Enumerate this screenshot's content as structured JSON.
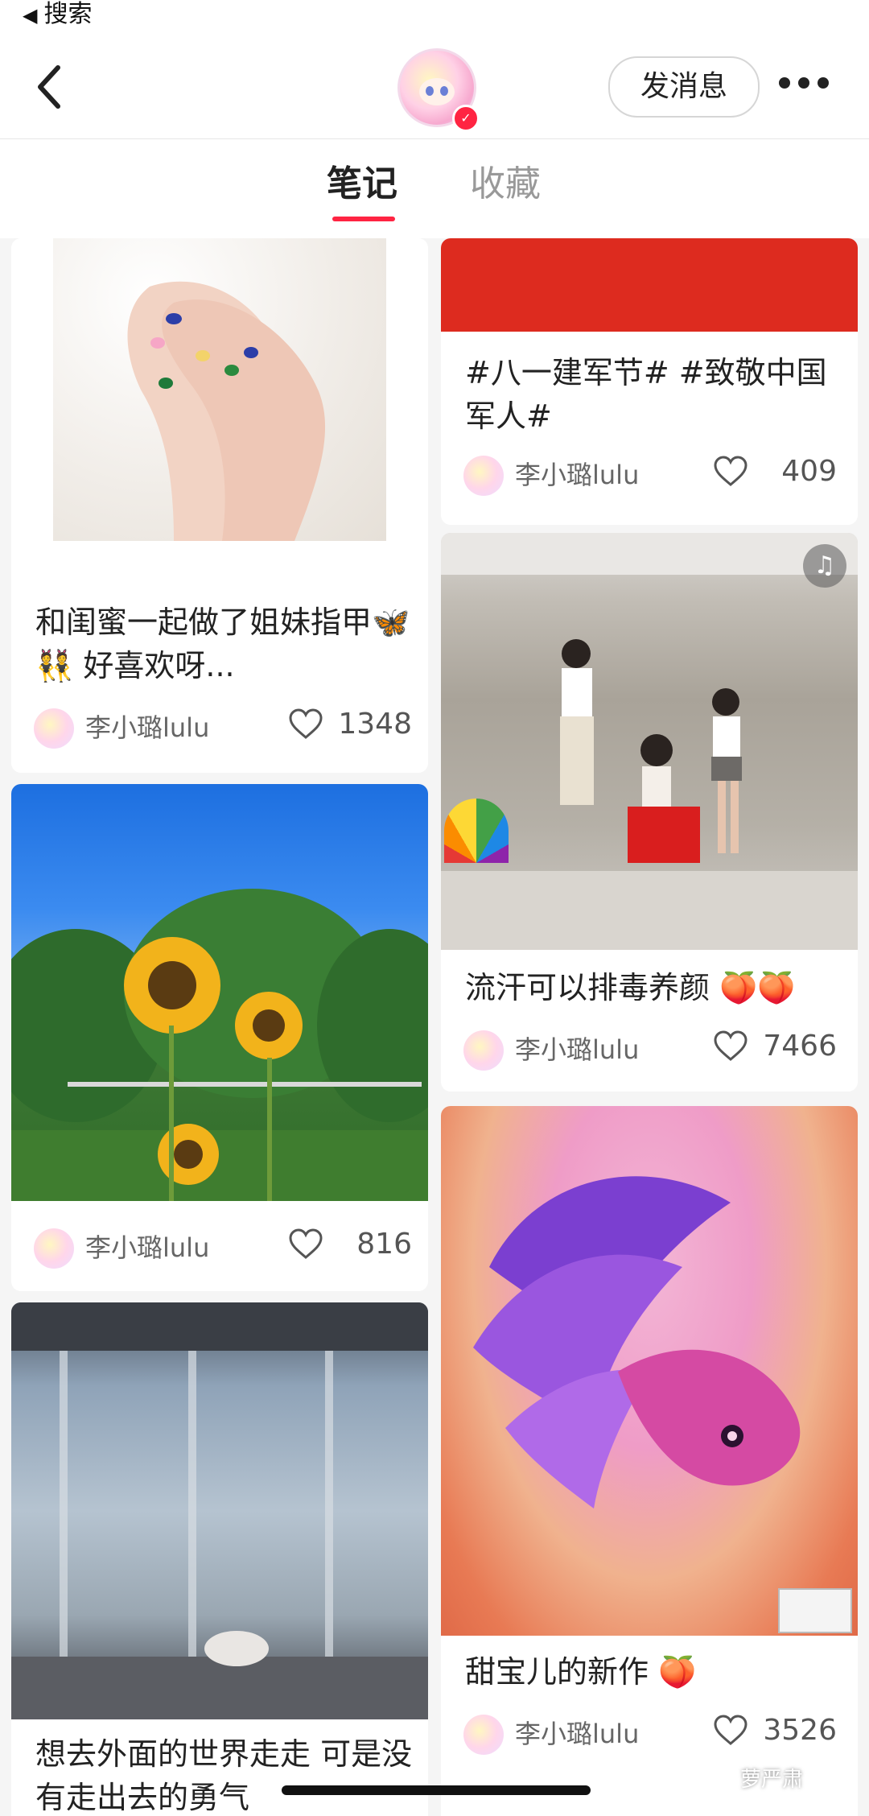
{
  "status_bar": {
    "back_label": "搜索"
  },
  "header": {
    "message_button": "发消息"
  },
  "tabs": [
    {
      "label": "笔记",
      "active": true
    },
    {
      "label": "收藏",
      "active": false
    }
  ],
  "accent_color": "#ff2442",
  "notes": [
    {
      "title": "和闺蜜一起做了姐妹指甲🦋👯 好喜欢呀...",
      "author": "李小璐lulu",
      "likes": "1348",
      "image": "nail-art-hands"
    },
    {
      "title": "#八一建军节# #致敬中国军人#",
      "author": "李小璐lulu",
      "likes": "409",
      "image": "red-banner"
    },
    {
      "title": "流汗可以排毒养颜 🍑🍑",
      "author": "李小璐lulu",
      "likes": "7466",
      "image": "dance-studio-photo",
      "has_music": true
    },
    {
      "title": "",
      "author": "李小璐lulu",
      "likes": "816",
      "image": "sunflowers"
    },
    {
      "title": "甜宝儿的新作 🍑",
      "author": "李小璐lulu",
      "likes": "3526",
      "image": "fish-painting"
    },
    {
      "title": "想去外面的世界走走 可是没有走出去的勇气",
      "author": "",
      "likes": "",
      "image": "window-curtain"
    }
  ],
  "watermark": "萝严肃",
  "icons": {
    "back": "chevron-left-icon",
    "more": "more-dots-icon",
    "like": "heart-icon",
    "music": "music-note-icon",
    "verified": "verified-badge-icon"
  }
}
